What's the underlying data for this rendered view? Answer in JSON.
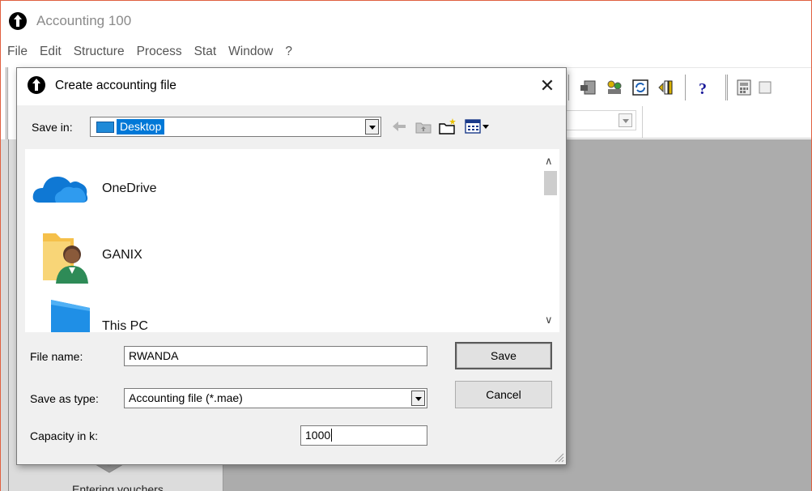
{
  "app": {
    "title": "Accounting 100"
  },
  "menu": [
    "File",
    "Edit",
    "Structure",
    "Process",
    "Stat",
    "Window",
    "?"
  ],
  "dialog": {
    "title": "Create accounting file",
    "close_glyph": "✕",
    "save_in": {
      "label": "Save in:",
      "value": "Desktop"
    },
    "items": [
      {
        "label": "OneDrive",
        "icon": "onedrive-cloud-icon"
      },
      {
        "label": "GANIX",
        "icon": "user-folder-icon"
      },
      {
        "label": "This PC",
        "icon": "computer-icon"
      }
    ],
    "file_name": {
      "label": "File name:",
      "value": "RWANDA"
    },
    "save_as_type": {
      "label": "Save as type:",
      "value": "Accounting file (*.mae)"
    },
    "capacity": {
      "label": "Capacity in k:",
      "value": "1000"
    },
    "save_button": "Save",
    "cancel_button": "Cancel"
  },
  "left_panel": {
    "partial_text": "Entering vouchers"
  },
  "colors": {
    "accent": "#0078d7",
    "workspace": "#acacac",
    "window_border": "#e06040"
  }
}
